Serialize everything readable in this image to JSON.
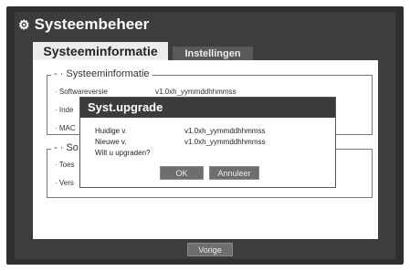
{
  "header": {
    "title": "Systeembeheer",
    "icon": "gear-icon"
  },
  "tabs": [
    {
      "label": "Systeeminformatie",
      "active": true
    },
    {
      "label": "Instellingen",
      "active": false
    }
  ],
  "sysinfo": {
    "title": "Systeeminformatie",
    "rows": [
      {
        "label": "· Softwareversie",
        "value": "v1.0xh_yymmddhhmmss"
      },
      {
        "label": "· Inde"
      },
      {
        "label": "· MAC"
      }
    ]
  },
  "group2": {
    "title": "So",
    "rows": [
      {
        "label": "· Toes"
      },
      {
        "label": "· Vers"
      }
    ]
  },
  "footer": {
    "prev_label": "Vorige"
  },
  "dialog": {
    "title": "Syst.upgrade",
    "current_label": "Huidige v.",
    "current_value": "v1.0xh_yymmddhhmmss",
    "new_label": "Nieuwe v.",
    "new_value": "v1.0xh_yymmddhhmmss",
    "question": "Wilt u upgraden?",
    "ok_label": "OK",
    "cancel_label": "Annuleer"
  }
}
